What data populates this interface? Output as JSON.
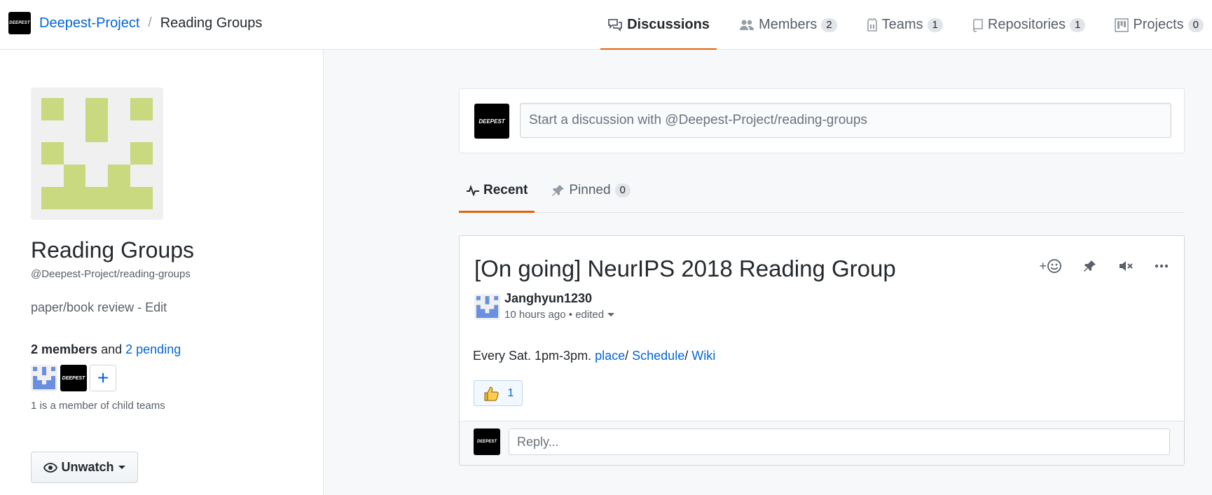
{
  "header": {
    "org_logo_text": "DEEPEST",
    "org_name": "Deepest-Project",
    "separator": "/",
    "team_name": "Reading Groups",
    "tabs": [
      {
        "label": "Discussions",
        "count": null,
        "icon": "comment-discussion-icon",
        "selected": true
      },
      {
        "label": "Members",
        "count": "2",
        "icon": "people-icon",
        "selected": false
      },
      {
        "label": "Teams",
        "count": "1",
        "icon": "jersey-icon",
        "selected": false
      },
      {
        "label": "Repositories",
        "count": "1",
        "icon": "repo-icon",
        "selected": false
      },
      {
        "label": "Projects",
        "count": "0",
        "icon": "project-icon",
        "selected": false
      }
    ]
  },
  "sidebar": {
    "team_name": "Reading Groups",
    "team_slug": "@Deepest-Project/reading-groups",
    "description": "paper/book review - Edit",
    "members_count": "2 members",
    "members_and": "and",
    "pending_link": "2 pending",
    "member_avatar_text": "DEEPEST",
    "add_member_symbol": "+",
    "child_teams_note": "1 is a member of child teams",
    "unwatch_label": "Unwatch"
  },
  "main": {
    "composer": {
      "avatar_text": "DEEPEST",
      "placeholder": "Start a discussion with @Deepest-Project/reading-groups"
    },
    "subtabs": [
      {
        "label": "Recent",
        "count": null,
        "selected": true
      },
      {
        "label": "Pinned",
        "count": "0",
        "selected": false
      }
    ],
    "post": {
      "title": "[On going] NeurIPS 2018 Reading Group",
      "author": "Janghyun1230",
      "time": "10 hours ago",
      "meta_sep": "•",
      "edited": "edited",
      "body_text": "Every Sat. 1pm-3pm.",
      "links": [
        "place",
        "Schedule",
        "Wiki"
      ],
      "link_sep": "/",
      "reaction_count": "1",
      "reply_placeholder": "Reply...",
      "reply_avatar_text": "DEEPEST",
      "add_reaction_plus": "+"
    }
  },
  "colors": {
    "accent_orange": "#e36209",
    "link_blue": "#0366d6",
    "identicon_green": "#c9d97f",
    "identicon_blue": "#6b8fe0"
  }
}
